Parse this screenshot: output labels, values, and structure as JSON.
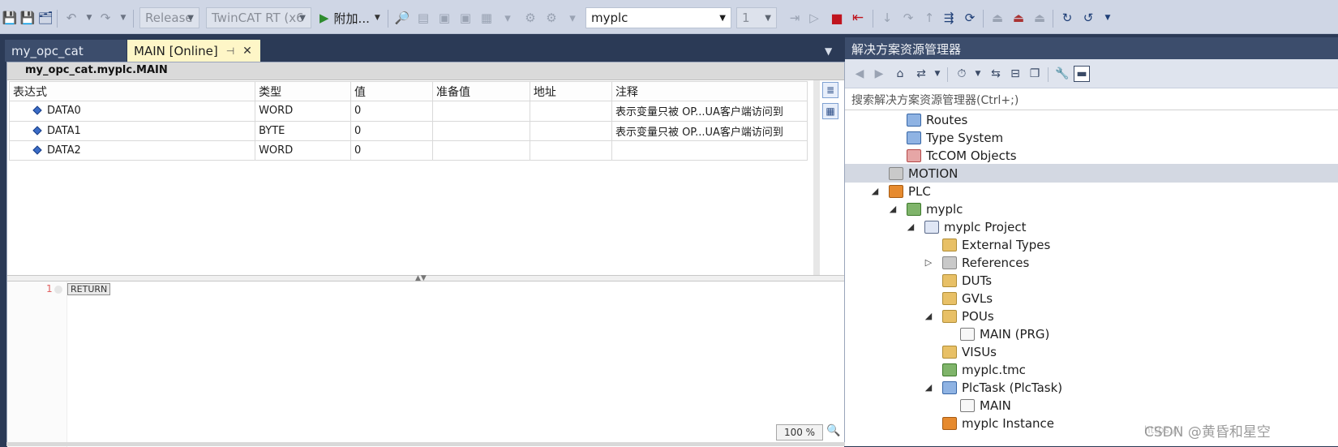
{
  "toolbar": {
    "config_dropdown": "Release",
    "platform_dropdown": "TwinCAT RT (x6",
    "attach_label": "附加...",
    "project_dropdown": "myplc",
    "task_dropdown": "1",
    "icons": [
      "save-icon",
      "save-all-icon",
      "undo-icon",
      "redo-icon",
      "play-icon",
      "search-icon",
      "stop-icon",
      "logout-icon",
      "step-into-icon",
      "step-over-icon",
      "step-out-icon",
      "show-next-statement-icon",
      "reset-icon",
      "login-icon",
      "logout-alt-icon",
      "refresh-icon"
    ]
  },
  "editor": {
    "tabs": [
      {
        "label": "my_opc_cat",
        "active": false
      },
      {
        "label": "MAIN [Online]",
        "active": true
      }
    ],
    "watch_title": "my_opc_cat.myplc.MAIN",
    "columns": [
      "表达式",
      "类型",
      "值",
      "准备值",
      "地址",
      "注释"
    ],
    "rows": [
      {
        "expr": "DATA0",
        "type": "WORD",
        "value": "0",
        "prepared": "",
        "address": "",
        "comment": "表示变量只被 OP...UA客户端访问到"
      },
      {
        "expr": "DATA1",
        "type": "BYTE",
        "value": "0",
        "prepared": "",
        "address": "",
        "comment": "表示变量只被 OP...UA客户端访问到"
      },
      {
        "expr": "DATA2",
        "type": "WORD",
        "value": "0",
        "prepared": "",
        "address": "",
        "comment": ""
      }
    ],
    "code": {
      "line_number": "1",
      "keyword": "RETURN"
    },
    "zoom": "100 %"
  },
  "solution_explorer": {
    "title": "解决方案资源管理器",
    "search_placeholder": "搜索解决方案资源管理器(Ctrl+;)",
    "tree": [
      {
        "label": "Routes",
        "indent": 3,
        "expander": "",
        "icon": "routes-icon"
      },
      {
        "label": "Type System",
        "indent": 3,
        "expander": "",
        "icon": "type-system-icon"
      },
      {
        "label": "TcCOM Objects",
        "indent": 3,
        "expander": "",
        "icon": "tccom-objects-icon"
      },
      {
        "label": "MOTION",
        "indent": 2,
        "expander": "",
        "icon": "motion-icon",
        "selected": true
      },
      {
        "label": "PLC",
        "indent": 1,
        "expander": "◢",
        "icon": "plc-icon"
      },
      {
        "label": "myplc",
        "indent": 2,
        "expander": "◢",
        "icon": "plc-project-icon"
      },
      {
        "label": "myplc Project",
        "indent": 3,
        "expander": "◢",
        "icon": "project-icon"
      },
      {
        "label": "External Types",
        "indent": 5,
        "expander": "",
        "icon": "folder-icon"
      },
      {
        "label": "References",
        "indent": 4,
        "expander": "▷",
        "icon": "references-icon"
      },
      {
        "label": "DUTs",
        "indent": 5,
        "expander": "",
        "icon": "folder-icon"
      },
      {
        "label": "GVLs",
        "indent": 5,
        "expander": "",
        "icon": "folder-icon"
      },
      {
        "label": "POUs",
        "indent": 4,
        "expander": "◢",
        "icon": "folder-open-icon"
      },
      {
        "label": "MAIN (PRG)",
        "indent": 6,
        "expander": "",
        "icon": "program-icon"
      },
      {
        "label": "VISUs",
        "indent": 5,
        "expander": "",
        "icon": "folder-icon"
      },
      {
        "label": "myplc.tmc",
        "indent": 5,
        "expander": "",
        "icon": "tmc-icon"
      },
      {
        "label": "PlcTask (PlcTask)",
        "indent": 4,
        "expander": "◢",
        "icon": "task-icon"
      },
      {
        "label": "MAIN",
        "indent": 6,
        "expander": "",
        "icon": "task-program-icon"
      },
      {
        "label": "myplc Instance",
        "indent": 4,
        "expander": "",
        "icon": "instance-icon"
      }
    ]
  },
  "watermark": "CSDN @黄昏和星空",
  "watermark_url": "https://"
}
